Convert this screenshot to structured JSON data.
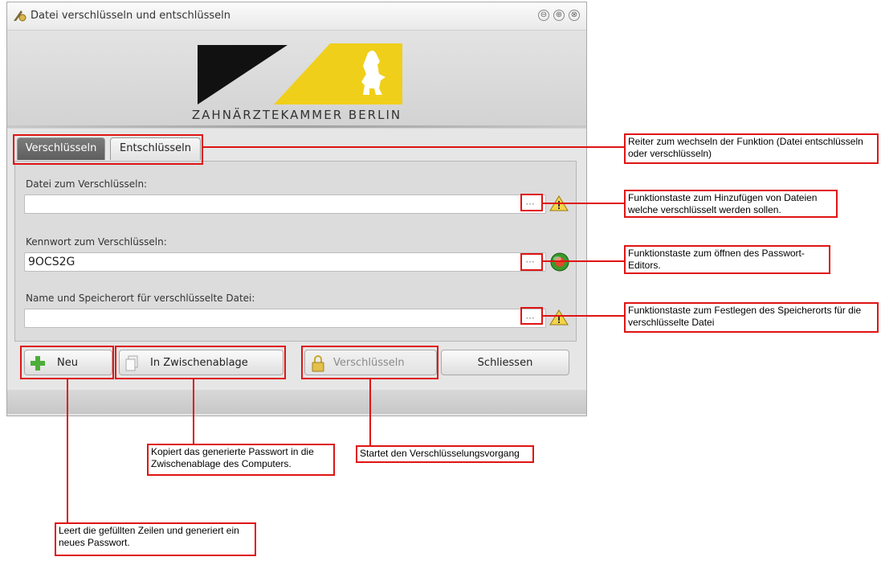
{
  "window": {
    "title": "Datei verschlüsseln und entschlüsseln",
    "buttons": [
      "⊖",
      "⊕",
      "⊗"
    ]
  },
  "header": {
    "org_name": "ZAHNÄRZTEKAMMER BERLIN",
    "logo_icon": "berlin-bear-logo-icon"
  },
  "tabs": [
    {
      "label": "Verschlüsseln",
      "active": true
    },
    {
      "label": "Entschlüsseln",
      "active": false
    }
  ],
  "form": {
    "file_label": "Datei zum Verschlüsseln:",
    "file_value": "",
    "password_label": "Kennwort zum Verschlüsseln:",
    "password_value": "9OCS2G",
    "output_label": "Name und Speicherort für verschlüsselte Datei:",
    "output_value": "",
    "browse_dots": "···",
    "status_icons": [
      "warning-icon",
      "ok-icon",
      "warning-icon"
    ]
  },
  "buttons": {
    "new": "Neu",
    "clipboard": "In Zwischenablage",
    "encrypt": "Verschlüsseln",
    "close": "Schliessen"
  },
  "annotations": {
    "tabs": "Reiter zum wechseln der Funktion (Datei entschlüsseln oder verschlüsseln)",
    "file": "Funktionstaste zum Hinzufügen von Dateien welche verschlüsselt werden sollen.",
    "password": "Funktionstaste zum öffnen des Passwort-Editors.",
    "output": "Funktionstaste zum Festlegen des Speicherorts für die verschlüsselte Datei",
    "clipboard": "Kopiert das generierte Passwort in die Zwischenablage des Computers.",
    "encrypt": "Startet den Verschlüsselungsvorgang",
    "new": "Leert die gefüllten Zeilen und generiert ein neues Passwort."
  },
  "colors": {
    "annotation_red": "#e01414",
    "logo_yellow": "#f0cf1a",
    "logo_black": "#111111"
  }
}
